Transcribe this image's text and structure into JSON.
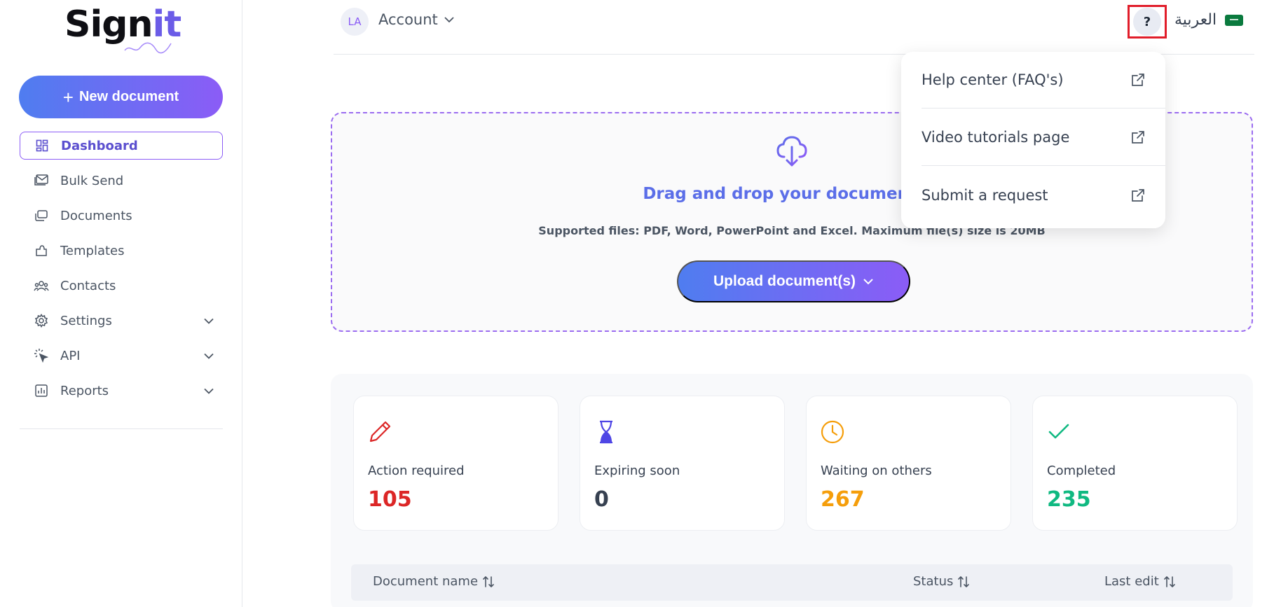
{
  "brand": {
    "logo_main": "Sign",
    "logo_accent": "it"
  },
  "sidebar": {
    "new_document": "New document",
    "items": [
      {
        "label": "Dashboard",
        "icon": "dashboard-icon",
        "active": true
      },
      {
        "label": "Bulk Send",
        "icon": "mail-stack-icon"
      },
      {
        "label": "Documents",
        "icon": "documents-icon"
      },
      {
        "label": "Templates",
        "icon": "templates-icon"
      },
      {
        "label": "Contacts",
        "icon": "contacts-icon"
      },
      {
        "label": "Settings",
        "icon": "gear-icon",
        "expandable": true
      },
      {
        "label": "API",
        "icon": "cursor-click-icon",
        "expandable": true
      },
      {
        "label": "Reports",
        "icon": "bar-chart-icon",
        "expandable": true
      }
    ]
  },
  "topbar": {
    "avatar_initials": "LA",
    "account_label": "Account",
    "help_symbol": "?",
    "language": "العربية"
  },
  "help_menu": {
    "items": [
      {
        "label": "Help center (FAQ's)"
      },
      {
        "label": "Video tutorials page"
      },
      {
        "label": "Submit a request"
      }
    ]
  },
  "dropzone": {
    "title": "Drag and drop your document(s)",
    "subtitle": "Supported files: PDF, Word, PowerPoint and Excel. Maximum file(s) size is 20MB",
    "upload_label": "Upload document(s)"
  },
  "stats": [
    {
      "label": "Action required",
      "value": "105",
      "color": "#dc2626",
      "icon": "pencil-icon"
    },
    {
      "label": "Expiring soon",
      "value": "0",
      "color": "#374151",
      "icon": "hourglass-icon"
    },
    {
      "label": "Waiting on others",
      "value": "267",
      "color": "#f59e0b",
      "icon": "clock-icon"
    },
    {
      "label": "Completed",
      "value": "235",
      "color": "#10b981",
      "icon": "check-icon"
    }
  ],
  "table": {
    "columns": [
      "Document name",
      "Status",
      "Last edit"
    ]
  },
  "colors": {
    "accent": "#8b5cf6",
    "primary": "#4f7df0",
    "highlight": "#e11d2a"
  }
}
